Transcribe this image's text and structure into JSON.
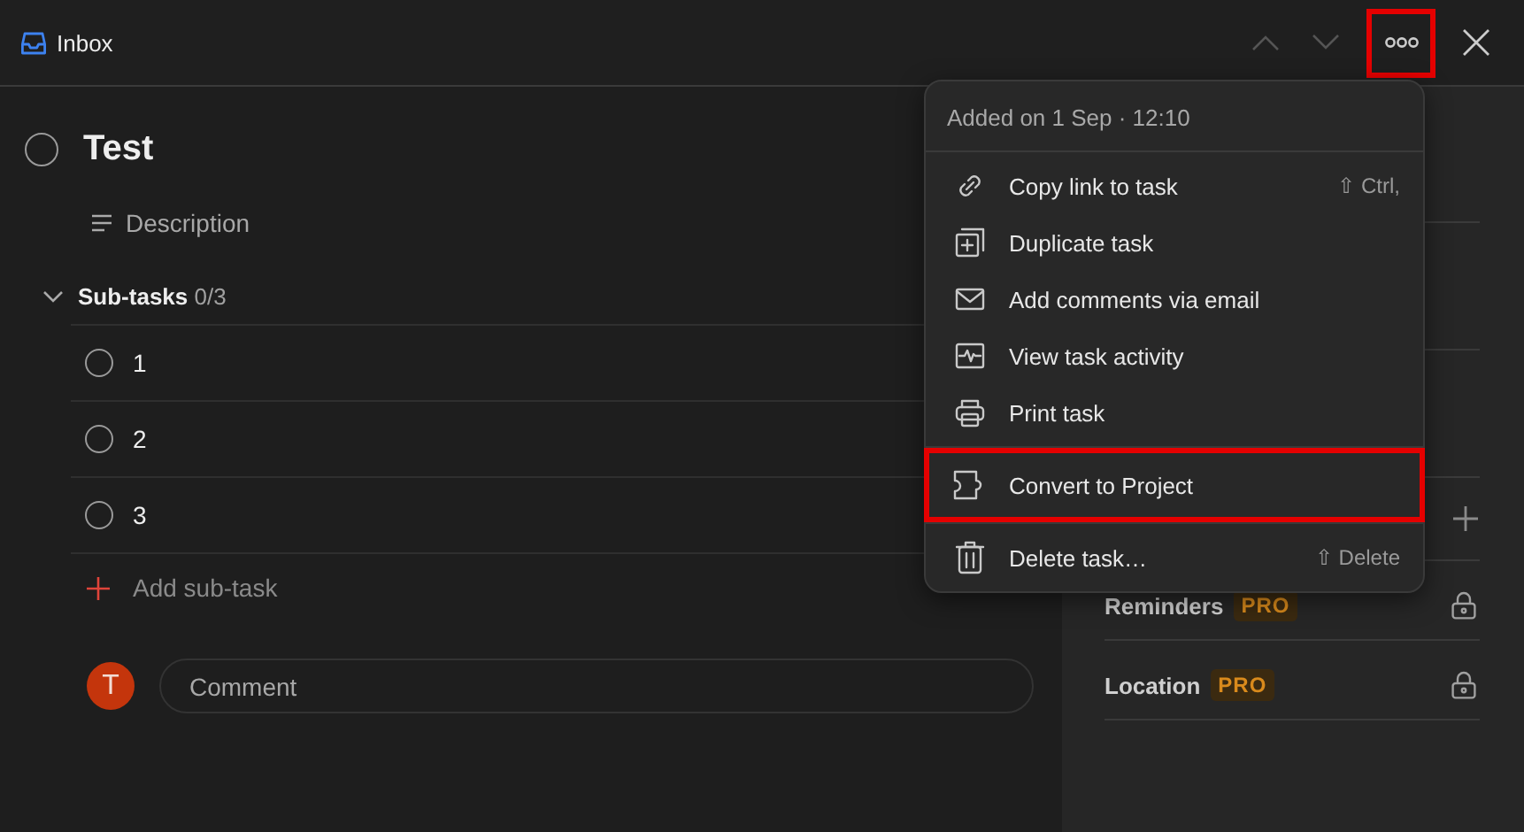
{
  "header": {
    "project": "Inbox",
    "more_highlighted": true
  },
  "task": {
    "title": "Test",
    "completed": false,
    "description_placeholder": "Description"
  },
  "subtasks": {
    "label": "Sub-tasks",
    "count": "0/3",
    "expanded": true,
    "items": [
      {
        "title": "1",
        "completed": false
      },
      {
        "title": "2",
        "completed": false
      },
      {
        "title": "3",
        "completed": false
      }
    ],
    "add_label": "Add sub-task"
  },
  "comment": {
    "avatar": "T",
    "placeholder": "Comment"
  },
  "sidebar": {
    "rows": [
      {
        "kind": "add"
      },
      {
        "kind": "locked",
        "label": "Reminders",
        "badge": "PRO"
      },
      {
        "kind": "locked",
        "label": "Location",
        "badge": "PRO"
      }
    ]
  },
  "menu": {
    "header": "Added on 1 Sep · 12:10",
    "groups": [
      [
        {
          "kind": "link",
          "label": "Copy link to task",
          "shortcut": "⇧ Ctrl,",
          "highlighted": false
        },
        {
          "kind": "duplicate",
          "label": "Duplicate task",
          "highlighted": false
        },
        {
          "kind": "email",
          "label": "Add comments via email",
          "highlighted": false
        },
        {
          "kind": "activity",
          "label": "View task activity",
          "highlighted": false
        },
        {
          "kind": "print",
          "label": "Print task",
          "highlighted": false
        }
      ],
      [
        {
          "kind": "convert",
          "label": "Convert to Project",
          "highlighted": true
        }
      ],
      [
        {
          "kind": "delete",
          "label": "Delete task…",
          "shortcut": "⇧ Delete",
          "highlighted": false
        }
      ]
    ]
  }
}
